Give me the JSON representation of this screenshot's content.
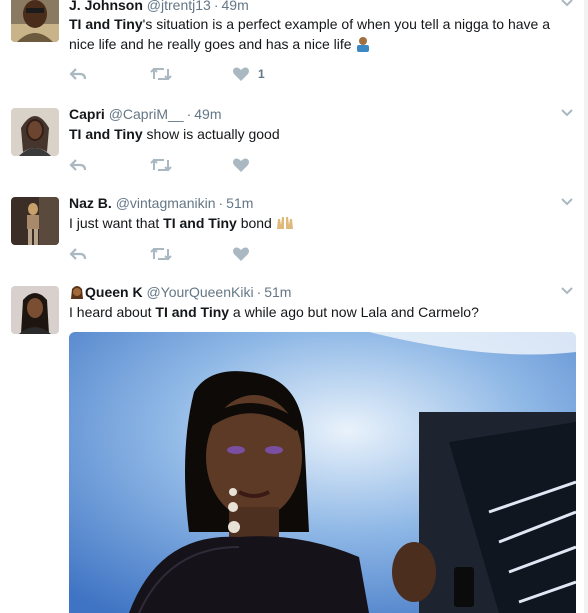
{
  "tweets": [
    {
      "name": "J. Johnson",
      "handle": "@jtrentj13",
      "time": "49m",
      "text_parts": [
        "TI and Tiny",
        "'s situation is a perfect example of when you tell a nigga to have a nice life and he really goes and has a nice life"
      ],
      "like_count": "1"
    },
    {
      "name": "Capri",
      "handle": "@CapriM__",
      "time": "49m",
      "text_parts": [
        "TI and Tiny",
        " show is actually good"
      ],
      "like_count": ""
    },
    {
      "name": "Naz B.",
      "handle": "@vintagmanikin",
      "time": "51m",
      "text_parts": [
        "I just want that ",
        "TI and Tiny",
        " bond"
      ],
      "like_count": ""
    },
    {
      "name": "Queen K",
      "handle": "@YourQueenKiki",
      "time": "51m",
      "text_parts": [
        "I heard about ",
        "TI and Tiny",
        " a while ago but now Lala and Carmelo?"
      ],
      "like_count": ""
    }
  ],
  "icons": {
    "reply": "reply-icon",
    "retweet": "retweet-icon",
    "like": "heart-icon",
    "caret": "chevron-down-icon"
  },
  "colors": {
    "icon_gray": "#aab8c2",
    "text_gray": "#657786",
    "border": "#e6ecf0"
  }
}
